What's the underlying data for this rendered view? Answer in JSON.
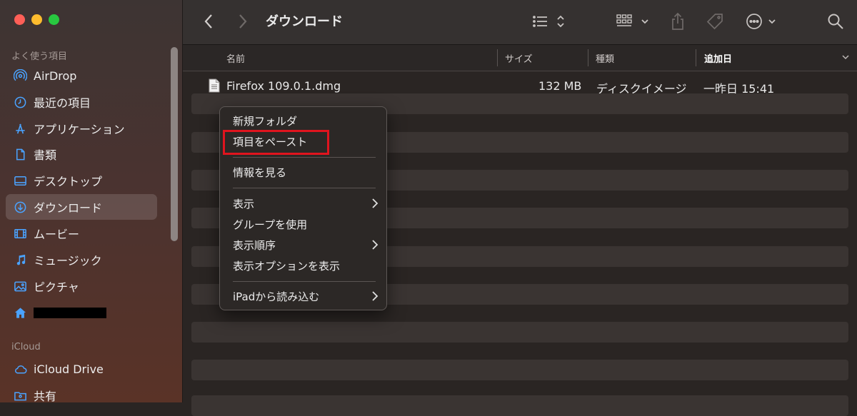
{
  "window": {
    "title": "ダウンロード"
  },
  "colors": {
    "accent": "#4aa3ff",
    "highlight": "#e0141e"
  },
  "sidebar": {
    "favorites_header": "よく使う項目",
    "icloud_header": "iCloud",
    "favorites": [
      {
        "label": "AirDrop",
        "icon": "airdrop-icon"
      },
      {
        "label": "最近の項目",
        "icon": "clock-icon"
      },
      {
        "label": "アプリケーション",
        "icon": "applications-icon"
      },
      {
        "label": "書類",
        "icon": "document-icon"
      },
      {
        "label": "デスクトップ",
        "icon": "desktop-icon"
      },
      {
        "label": "ダウンロード",
        "icon": "download-icon",
        "selected": true
      },
      {
        "label": "ムービー",
        "icon": "film-icon"
      },
      {
        "label": "ミュージック",
        "icon": "music-icon"
      },
      {
        "label": "ピクチャ",
        "icon": "photo-icon"
      },
      {
        "label": "",
        "icon": "home-icon",
        "redacted": true
      }
    ],
    "icloud": [
      {
        "label": "iCloud Drive",
        "icon": "cloud-icon"
      },
      {
        "label": "共有",
        "icon": "shared-folder-icon"
      }
    ]
  },
  "columns": {
    "name": "名前",
    "size": "サイズ",
    "kind": "種類",
    "date_added": "追加日"
  },
  "files": [
    {
      "name": "Firefox 109.0.1.dmg",
      "size": "132 MB",
      "kind": "ディスクイメージ",
      "date_added": "一昨日 15:41",
      "icon": "file-icon"
    }
  ],
  "context_menu": {
    "items": [
      {
        "label": "新規フォルダ"
      },
      {
        "label": "項目をペースト",
        "highlighted": true
      },
      {
        "label": "情報を見る"
      },
      {
        "label": "表示",
        "submenu": true
      },
      {
        "label": "グループを使用"
      },
      {
        "label": "表示順序",
        "submenu": true
      },
      {
        "label": "表示オプションを表示"
      },
      {
        "label": "iPadから読み込む",
        "submenu": true
      }
    ]
  }
}
